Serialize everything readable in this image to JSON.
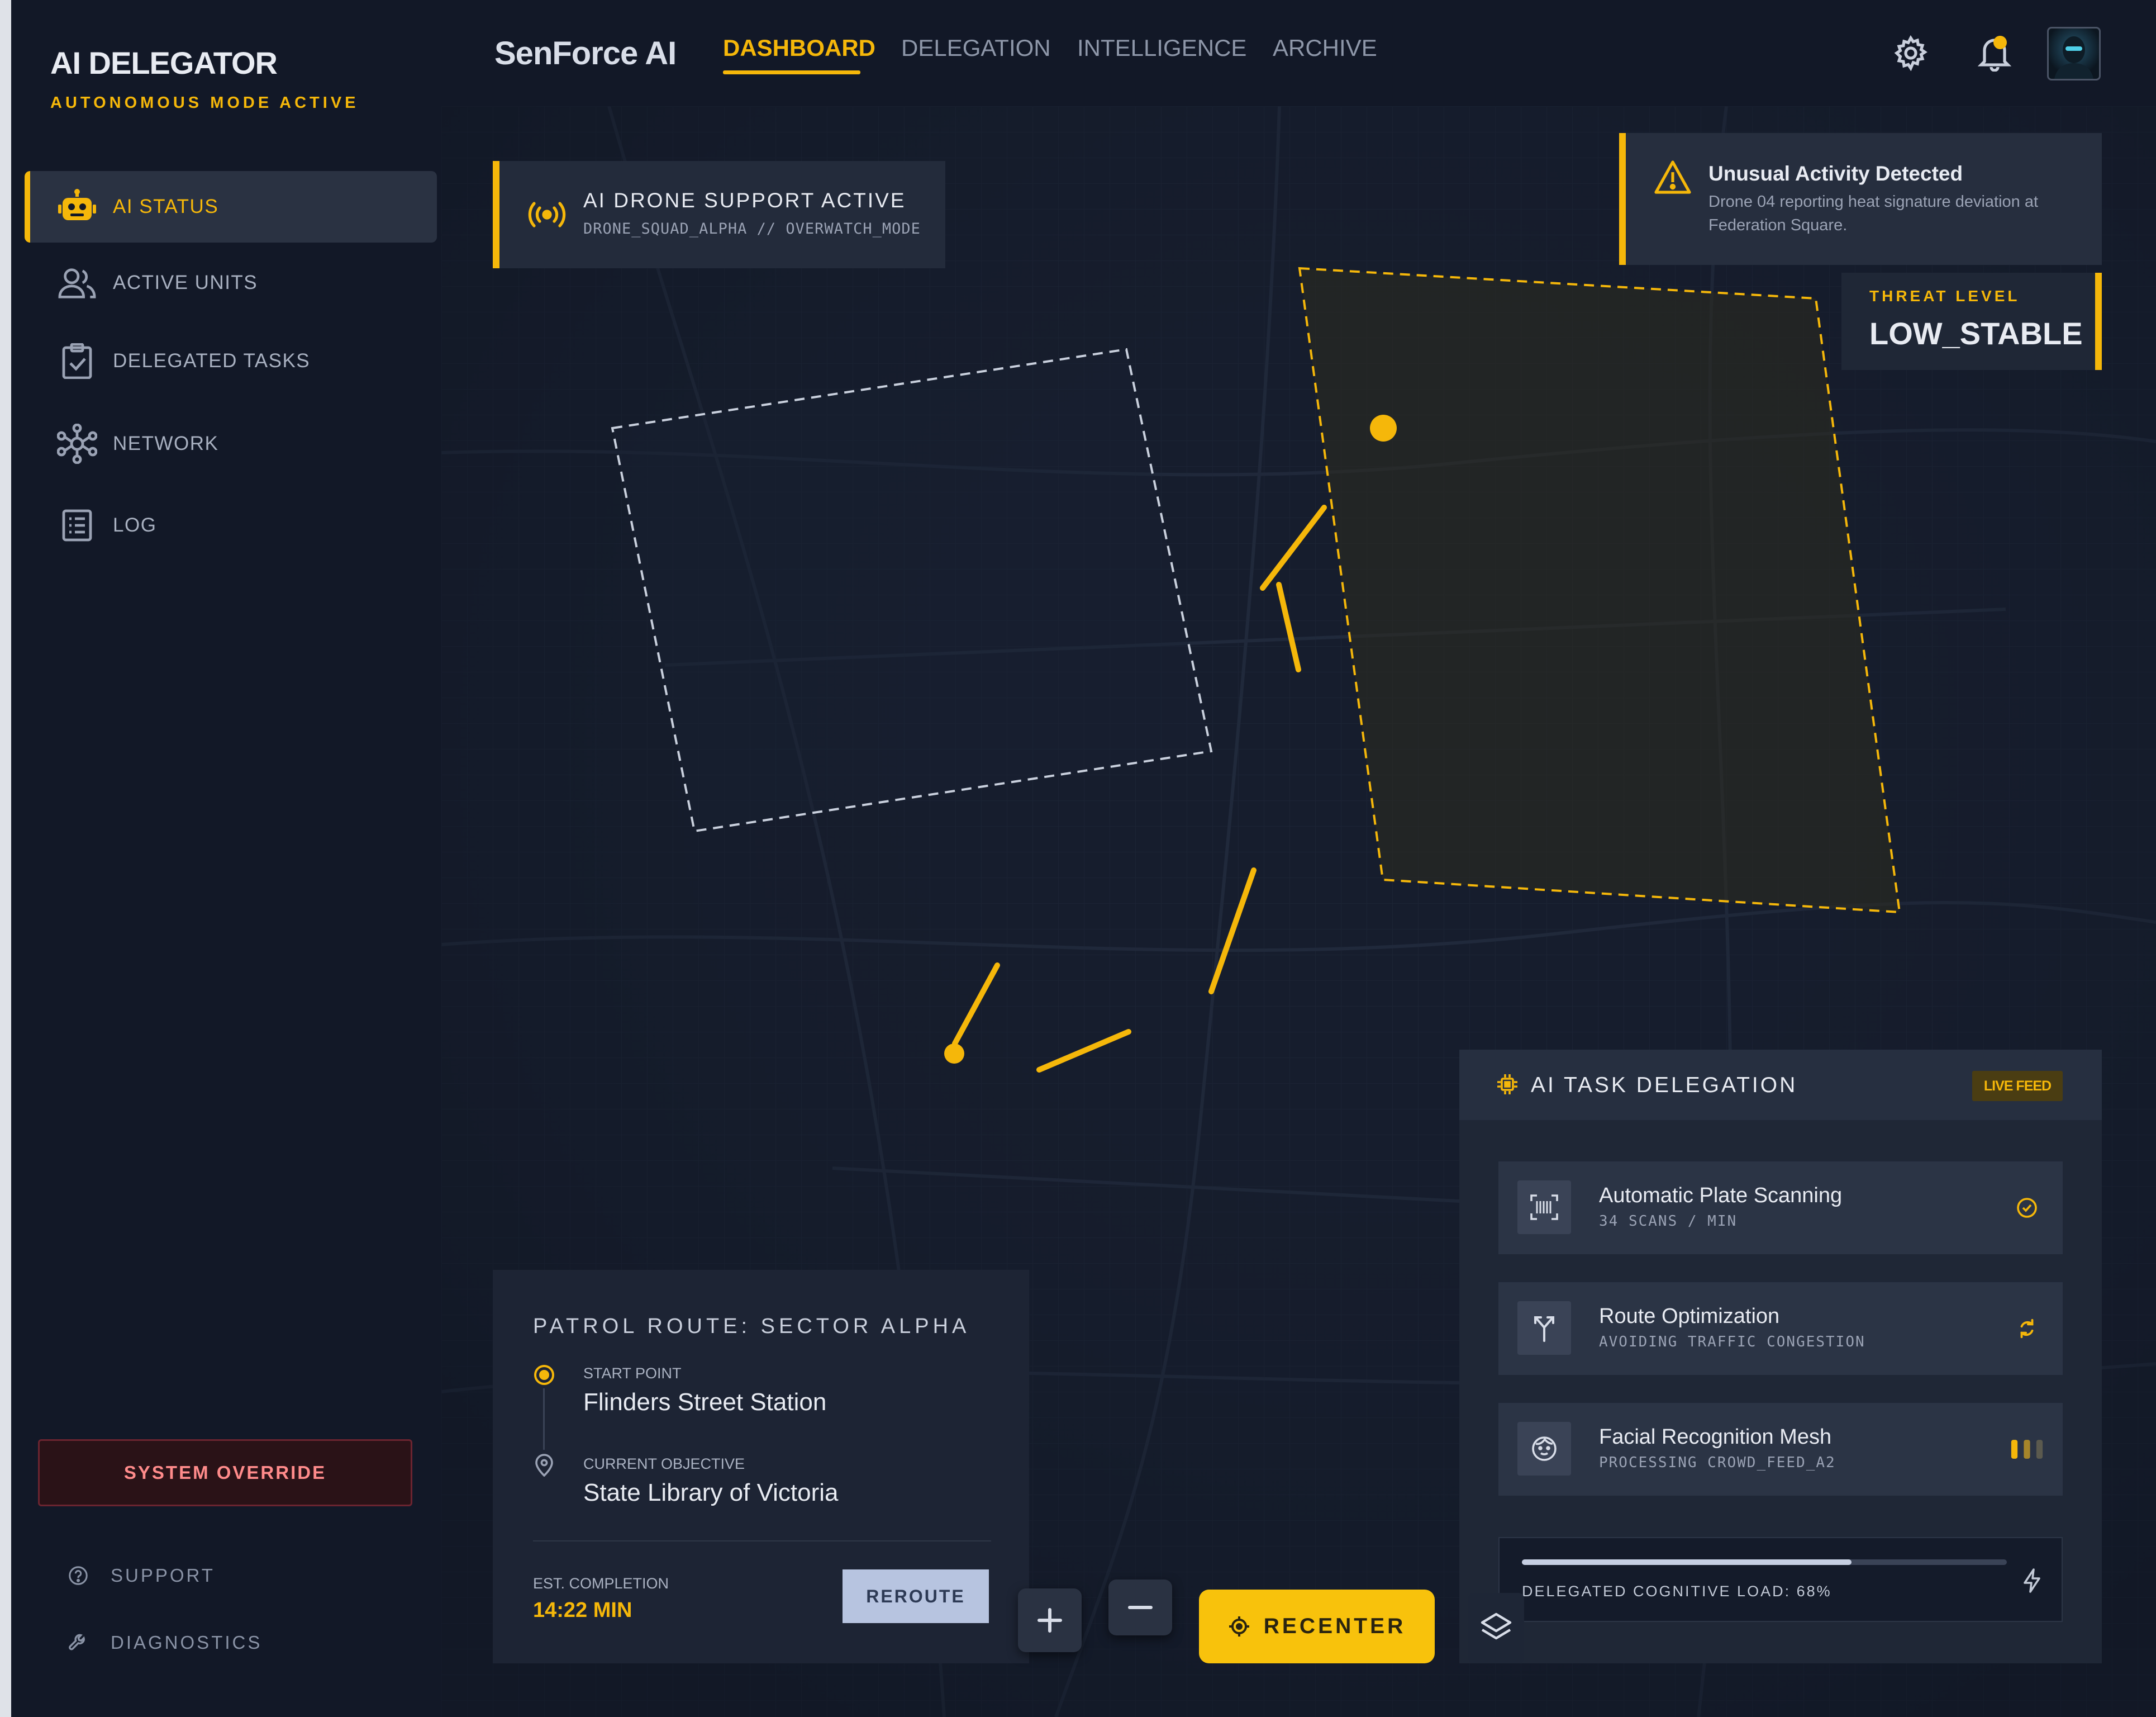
{
  "sidebar": {
    "title": "AI DELEGATOR",
    "subtitle": "AUTONOMOUS MODE ACTIVE",
    "items": [
      {
        "label": "AI STATUS",
        "icon": "robot-icon",
        "active": true
      },
      {
        "label": "ACTIVE UNITS",
        "icon": "users-icon"
      },
      {
        "label": "DELEGATED TASKS",
        "icon": "clipboard-check-icon"
      },
      {
        "label": "NETWORK",
        "icon": "network-hub-icon"
      },
      {
        "label": "LOG",
        "icon": "list-icon"
      }
    ],
    "override_label": "SYSTEM OVERRIDE",
    "support_label": "SUPPORT",
    "diagnostics_label": "DIAGNOSTICS"
  },
  "header": {
    "logo": "SenForce AI",
    "tabs": [
      {
        "label": "DASHBOARD",
        "active": true
      },
      {
        "label": "DELEGATION"
      },
      {
        "label": "INTELLIGENCE"
      },
      {
        "label": "ARCHIVE"
      }
    ],
    "icons": [
      "gear-icon",
      "bell-icon",
      "avatar"
    ]
  },
  "drone": {
    "title": "AI DRONE SUPPORT ACTIVE",
    "subtitle": "DRONE_SQUAD_ALPHA // OVERWATCH_MODE"
  },
  "alert": {
    "title": "Unusual Activity Detected",
    "body": "Drone 04 reporting heat signature deviation at Federation Square."
  },
  "threat": {
    "label": "THREAT LEVEL",
    "value": "LOW_STABLE"
  },
  "patrol": {
    "title": "PATROL ROUTE: SECTOR ALPHA",
    "start_label": "START POINT",
    "start_value": "Flinders Street Station",
    "objective_label": "CURRENT OBJECTIVE",
    "objective_value": "State Library of Victoria",
    "eta_label": "EST. COMPLETION",
    "eta_value": "14:22 MIN",
    "reroute_label": "REROUTE"
  },
  "controls": {
    "recenter_label": "RECENTER"
  },
  "tasks": {
    "title": "AI TASK DELEGATION",
    "badge": "LIVE FEED",
    "items": [
      {
        "name": "Automatic Plate Scanning",
        "detail": "34 SCANS / MIN",
        "icon": "barcode-scan-icon",
        "status": "check-circle-icon"
      },
      {
        "name": "Route Optimization",
        "detail": "AVOIDING TRAFFIC CONGESTION",
        "icon": "route-split-icon",
        "status": "sync-icon"
      },
      {
        "name": "Facial Recognition Mesh",
        "detail": "PROCESSING CROWD_FEED_A2",
        "icon": "face-icon",
        "status": "signal-bars-icon"
      }
    ],
    "load_label": "DELEGATED COGNITIVE LOAD: 68%",
    "load_value": 0.68
  },
  "colors": {
    "accent": "#f5b70a",
    "background": "#141b2b",
    "panel": "#232b3b"
  }
}
